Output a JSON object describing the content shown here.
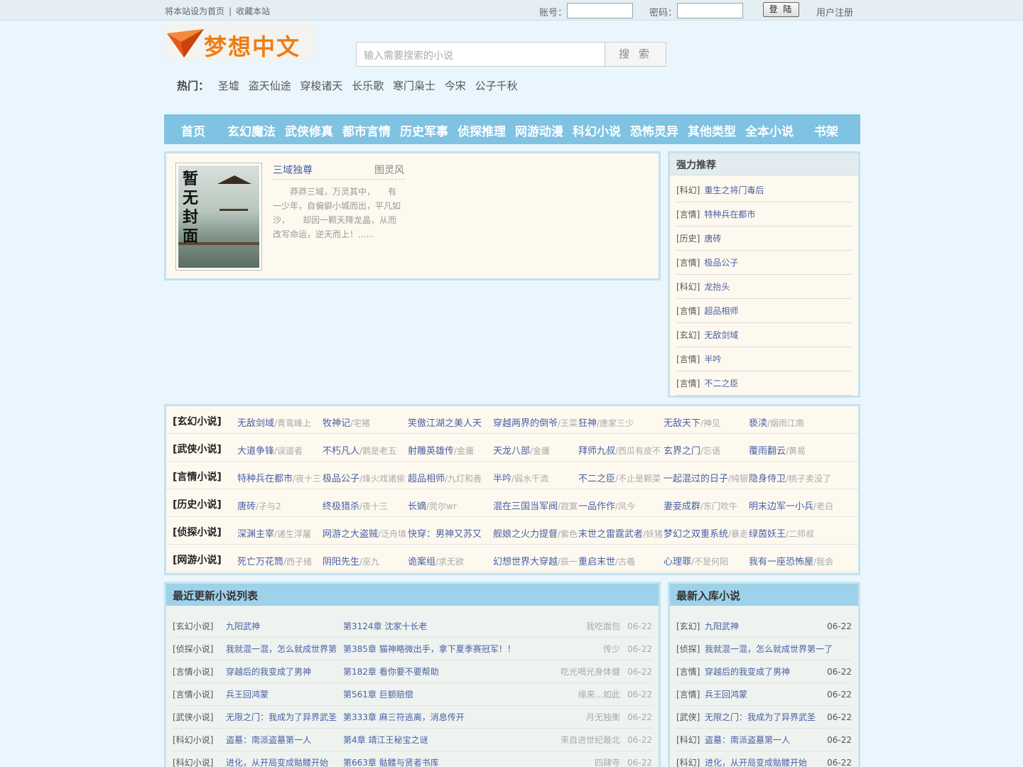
{
  "topbar": {
    "set_home": "将本站设为首页",
    "separator": "|",
    "bookmark": "收藏本站",
    "account_label": "账号：",
    "password_label": "密码：",
    "login": "登 陆",
    "register": "用户注册"
  },
  "logo_text": "梦想中文",
  "search": {
    "placeholder": "输入需要搜索的小说",
    "button": "搜 索"
  },
  "hot": {
    "label": "热门：",
    "items": [
      "圣墟",
      "盗天仙途",
      "穿梭诸天",
      "长乐歌",
      "寒门枭士",
      "今宋",
      "公子千秋"
    ]
  },
  "nav": [
    "首页",
    "玄幻魔法",
    "武侠修真",
    "都市言情",
    "历史军事",
    "侦探推理",
    "网游动漫",
    "科幻小说",
    "恐怖灵异",
    "其他类型",
    "全本小说",
    "书架"
  ],
  "featured": {
    "cover_text": [
      "暂",
      "无",
      "封",
      "面"
    ],
    "title": "三域独尊",
    "author": "图灵风",
    "desc": "莽莽三域，万灵其中，　　有一少年，自偏僻小城而出，平凡如沙，　　却因一颗天降龙晶，从而改写命运，逆天而上！......"
  },
  "recommend": {
    "title": "强力推荐",
    "items": [
      {
        "cat": "[科幻]",
        "name": "重生之将门毒后"
      },
      {
        "cat": "[言情]",
        "name": "特种兵在都市"
      },
      {
        "cat": "[历史]",
        "name": "唐砖"
      },
      {
        "cat": "[言情]",
        "name": "极品公子"
      },
      {
        "cat": "[科幻]",
        "name": "龙抬头"
      },
      {
        "cat": "[言情]",
        "name": "超品相师"
      },
      {
        "cat": "[玄幻]",
        "name": "无敌剑域"
      },
      {
        "cat": "[言情]",
        "name": "半吟"
      },
      {
        "cat": "[言情]",
        "name": "不二之臣"
      }
    ]
  },
  "categories": [
    {
      "name": "[玄幻小说]",
      "books": [
        [
          "无敌剑域",
          "/青鸾峰上"
        ],
        [
          "牧神记",
          "/宅猪"
        ],
        [
          "笑傲江湖之美人天",
          ""
        ],
        [
          "穿越两界的倒爷",
          "/王菜"
        ],
        [
          "狂神",
          "/唐家三少"
        ],
        [
          "无敌天下",
          "/神见"
        ],
        [
          "亵渎",
          "/烟雨江南"
        ]
      ]
    },
    {
      "name": "[武侠小说]",
      "books": [
        [
          "大道争锋",
          "/误道者"
        ],
        [
          "不朽凡人",
          "/鹅是老五"
        ],
        [
          "射雕英雄传",
          "/金庸"
        ],
        [
          "天龙八部",
          "/金庸"
        ],
        [
          "拜师九叔",
          "/西瓜有皮不"
        ],
        [
          "玄界之门",
          "/忘语"
        ],
        [
          "覆雨翻云",
          "/黄易"
        ]
      ]
    },
    {
      "name": "[言情小说]",
      "books": [
        [
          "特种兵在都市",
          "/夜十三"
        ],
        [
          "极品公子",
          "/烽火戏诸侯"
        ],
        [
          "超品相师",
          "/九灯和善"
        ],
        [
          "半吟",
          "/弱水千流"
        ],
        [
          "不二之臣",
          "/不止是颗菜"
        ],
        [
          "一起混过的日子",
          "/纯银"
        ],
        [
          "隐身侍卫",
          "/桃子卖没了"
        ]
      ]
    },
    {
      "name": "[历史小说]",
      "books": [
        [
          "唐砖",
          "/孑与2"
        ],
        [
          "终极猎杀",
          "/夜十三"
        ],
        [
          "长嫡",
          "/莞尔wr"
        ],
        [
          "混在三国当军阀",
          "/寂寞"
        ],
        [
          "一品作作",
          "/风今"
        ],
        [
          "妻妾成群",
          "/东门吹牛"
        ],
        [
          "明末边军一小兵",
          "/老白"
        ]
      ]
    },
    {
      "name": "[侦探小说]",
      "books": [
        [
          "深渊主宰",
          "/诸生浮屠"
        ],
        [
          "网游之大盗贼",
          "/泛舟填"
        ],
        [
          "快穿：男神又苏又",
          ""
        ],
        [
          "舰娘之火力提督",
          "/紫色"
        ],
        [
          "末世之雷霆武者",
          "/妖猪"
        ],
        [
          "梦幻之双重系统",
          "/暴走"
        ],
        [
          "绿茵妖王",
          "/二师叔"
        ]
      ]
    },
    {
      "name": "[网游小说]",
      "books": [
        [
          "死亡万花筒",
          "/西子绪"
        ],
        [
          "阴阳先生",
          "/巫九"
        ],
        [
          "诡案组",
          "/求无欲"
        ],
        [
          "幻想世界大穿越",
          "/辰一"
        ],
        [
          "重启末世",
          "/古羲"
        ],
        [
          "心理罪",
          "/不是何阳"
        ],
        [
          "我有一座恐怖屋",
          "/我会"
        ]
      ]
    }
  ],
  "updates": {
    "title": "最近更新小说列表",
    "rows": [
      {
        "cat": "[玄幻小说]",
        "name": "九阳武神",
        "chapter": "第3124章 沈家十长老",
        "author": "我吃面包",
        "date": "06-22"
      },
      {
        "cat": "[侦探小说]",
        "name": "我就混一混，怎么就成世界第",
        "chapter": "第385章 猫神略微出手，拿下夏季赛冠军！！",
        "author": "传少",
        "date": "06-22"
      },
      {
        "cat": "[言情小说]",
        "name": "穿越后的我变成了男神",
        "chapter": "第182章 看你要不要帮助",
        "author": "吃光喝光身体健",
        "date": "06-22"
      },
      {
        "cat": "[言情小说]",
        "name": "兵王回鸿蒙",
        "chapter": "第561章 巨额赔偿",
        "author": "缘来...如此",
        "date": "06-22"
      },
      {
        "cat": "[武侠小说]",
        "name": "无限之门：我成为了异界武圣",
        "chapter": "第333章 麻三符逃离，消息传开",
        "author": "月无独衡",
        "date": "06-22"
      },
      {
        "cat": "[科幻小说]",
        "name": "盗墓：南派盗墓第一人",
        "chapter": "第4章 靖江王秘宝之谜",
        "author": "来自进世纪最北",
        "date": "06-22"
      },
      {
        "cat": "[科幻小说]",
        "name": "进化，从开局变成骷髅开始",
        "chapter": "第663章 骷髅与贤者书库",
        "author": "四肆寺",
        "date": "06-22"
      }
    ]
  },
  "newest": {
    "title": "最新入库小说",
    "rows": [
      {
        "cat": "[玄幻]",
        "name": "九阳武神",
        "date": "06-22"
      },
      {
        "cat": "[侦探]",
        "name": "我就混一混，怎么就成世界第一了",
        "date": ""
      },
      {
        "cat": "[言情]",
        "name": "穿越后的我变成了男神",
        "date": "06-22"
      },
      {
        "cat": "[言情]",
        "name": "兵王回鸿蒙",
        "date": "06-22"
      },
      {
        "cat": "[武侠]",
        "name": "无限之门：我成为了异界武圣",
        "date": "06-22"
      },
      {
        "cat": "[科幻]",
        "name": "盗墓：南派盗墓第一人",
        "date": "06-22"
      },
      {
        "cat": "[科幻]",
        "name": "进化，从开局变成骷髅开始",
        "date": "06-22"
      }
    ]
  }
}
